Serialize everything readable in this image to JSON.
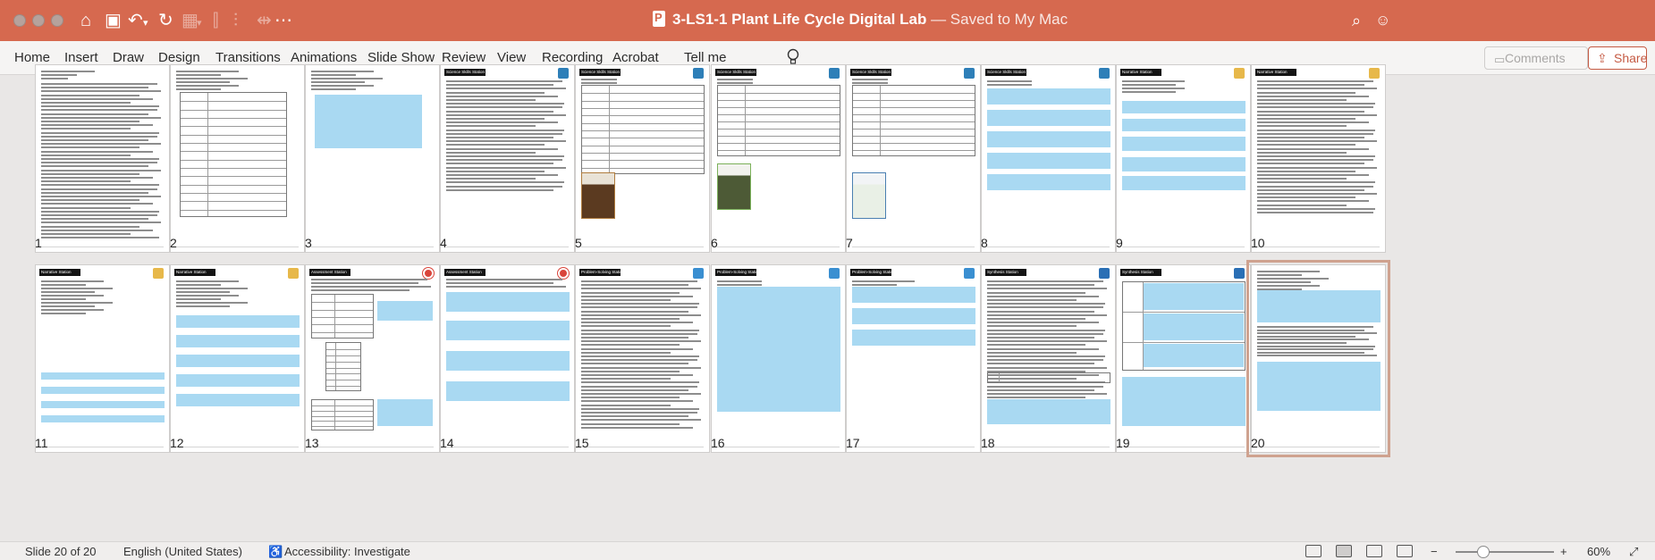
{
  "window": {
    "title": "3-LS1-1 Plant Life Cycle Digital Lab",
    "status": "— Saved to My Mac"
  },
  "ribbon": {
    "tabs": [
      "Home",
      "Insert",
      "Draw",
      "Design",
      "Transitions",
      "Animations",
      "Slide Show",
      "Review",
      "View",
      "Recording",
      "Acrobat"
    ],
    "tell_me": "Tell me",
    "comments_label": "Comments",
    "share_label": "Share"
  },
  "slides": [
    {
      "number": "1",
      "header": "",
      "icon": ""
    },
    {
      "number": "2",
      "header": "",
      "icon": ""
    },
    {
      "number": "3",
      "header": "",
      "icon": ""
    },
    {
      "number": "4",
      "header": "Science Skills Station",
      "icon": "microscope-icon"
    },
    {
      "number": "5",
      "header": "Science Skills Station",
      "icon": "microscope-icon"
    },
    {
      "number": "6",
      "header": "Science Skills Station",
      "icon": "microscope-icon"
    },
    {
      "number": "7",
      "header": "Science Skills Station",
      "icon": "microscope-icon"
    },
    {
      "number": "8",
      "header": "Science Skills Station",
      "icon": "microscope-icon"
    },
    {
      "number": "9",
      "header": "Narrative Station",
      "icon": "book-icon"
    },
    {
      "number": "10",
      "header": "Narrative Station",
      "icon": "book-icon"
    },
    {
      "number": "11",
      "header": "Narrative Station",
      "icon": "book-icon"
    },
    {
      "number": "12",
      "header": "Narrative Station",
      "icon": "book-icon"
    },
    {
      "number": "13",
      "header": "Assessment Station",
      "icon": "target-icon"
    },
    {
      "number": "14",
      "header": "Assessment Station",
      "icon": "target-icon"
    },
    {
      "number": "15",
      "header": "Problem-Solving Station",
      "icon": "puzzle-icon"
    },
    {
      "number": "16",
      "header": "Problem-Solving Station",
      "icon": "puzzle-icon"
    },
    {
      "number": "17",
      "header": "Problem-Solving Station",
      "icon": "puzzle-icon"
    },
    {
      "number": "18",
      "header": "Synthesis Station",
      "icon": "atom-icon"
    },
    {
      "number": "19",
      "header": "Synthesis Station",
      "icon": "atom-icon"
    },
    {
      "number": "20",
      "header": "",
      "icon": ""
    }
  ],
  "statusbar": {
    "slide_position": "Slide 20 of 20",
    "language": "English (United States)",
    "accessibility": "Accessibility: Investigate",
    "zoom": "60%"
  },
  "colors": {
    "titlebar": "#d6694f",
    "box_fill": "#a9d9f2",
    "microscope": "#2e7fb8",
    "book": "#e7b84a",
    "target": "#d9453b",
    "puzzle": "#3a8fd1",
    "atom": "#2a6fb5"
  }
}
